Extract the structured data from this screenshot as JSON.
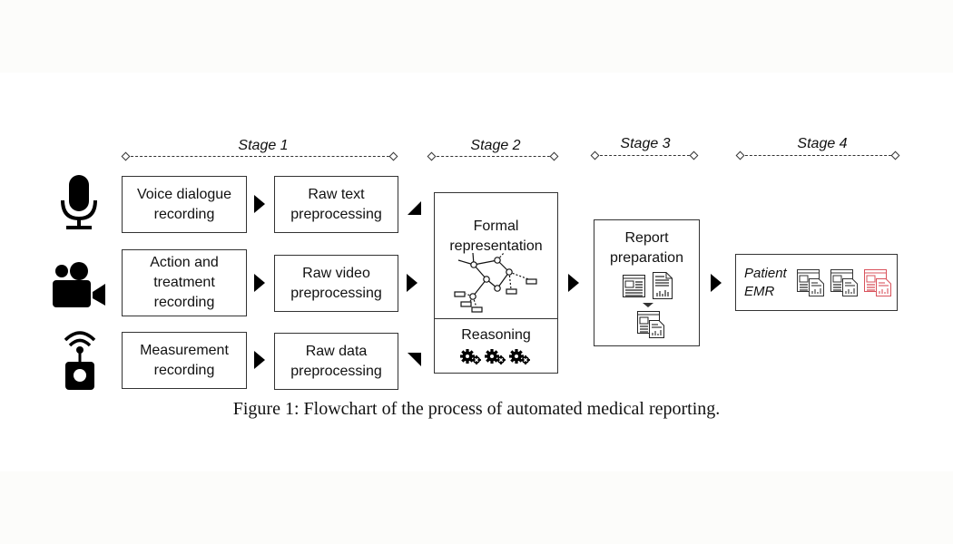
{
  "figure": {
    "caption": "Figure 1: Flowchart of the process of automated medical reporting."
  },
  "stages": [
    {
      "label": "Stage 1"
    },
    {
      "label": "Stage 2"
    },
    {
      "label": "Stage 3"
    },
    {
      "label": "Stage 4"
    }
  ],
  "inputs": [
    {
      "icon": "microphone-icon",
      "recording": [
        "Voice dialogue",
        "recording"
      ],
      "preprocessing": [
        "Raw text",
        "preprocessing"
      ]
    },
    {
      "icon": "video-camera-icon",
      "recording": [
        "Action and",
        "treatment",
        "recording"
      ],
      "preprocessing": [
        "Raw video",
        "preprocessing"
      ]
    },
    {
      "icon": "wireless-sensor-icon",
      "recording": [
        "Measurement",
        "recording"
      ],
      "preprocessing": [
        "Raw data",
        "preprocessing"
      ]
    }
  ],
  "stage2": {
    "title": [
      "Formal",
      "representation"
    ],
    "graph_icon": "knowledge-graph-icon",
    "reasoning": "Reasoning",
    "reasoning_icon": "gears-icon"
  },
  "stage3": {
    "title": [
      "Report",
      "preparation"
    ],
    "icons": [
      "document-layout-icon",
      "chart-report-icon",
      "combined-report-icon"
    ]
  },
  "stage4": {
    "label": [
      "Patient",
      "EMR"
    ],
    "report_icons": [
      {
        "name": "report-icon",
        "color": "#333333"
      },
      {
        "name": "report-icon",
        "color": "#333333"
      },
      {
        "name": "report-icon-highlighted",
        "color": "#d9535c"
      }
    ]
  }
}
